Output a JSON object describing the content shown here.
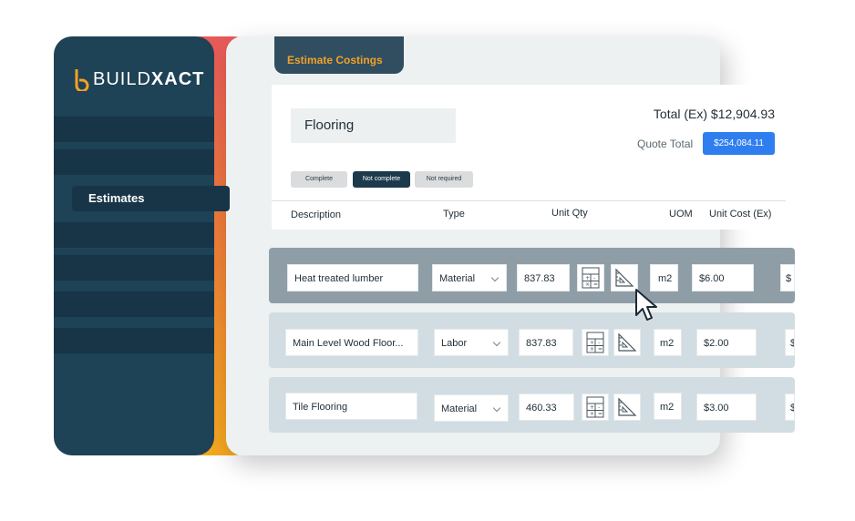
{
  "brand": {
    "name_light": "BUILD",
    "name_bold": "XACT"
  },
  "sidebar": {
    "active_item": "Estimates"
  },
  "tab": {
    "label": "Estimate Costings"
  },
  "header": {
    "category": "Flooring",
    "total_label": "Total (Ex) $12,904.93",
    "quote_total_label": "Quote Total",
    "quote_total_value": "$254,084.11"
  },
  "status_pills": [
    "Complete",
    "Not complete",
    "Not required"
  ],
  "columns": [
    "Description",
    "Type",
    "Unit Qty",
    "UOM",
    "Unit Cost (Ex)"
  ],
  "rows": [
    {
      "description": "Heat treated lumber",
      "type": "Material",
      "qty": "837.83",
      "uom": "m2",
      "unit_cost": "$6.00",
      "extra": "$"
    },
    {
      "description": "Main Level Wood Floor...",
      "type": "Labor",
      "qty": "837.83",
      "uom": "m2",
      "unit_cost": "$2.00",
      "extra": "$"
    },
    {
      "description": "Tile Flooring",
      "type": "Material",
      "qty": "460.33",
      "uom": "m2",
      "unit_cost": "$3.00",
      "extra": "$"
    }
  ],
  "colors": {
    "sidebar": "#1e4256",
    "accent_orange": "#f1a126",
    "quote_button": "#2f7ef0",
    "selected_row": "#8f9ea6",
    "row": "#d1dde3"
  },
  "icons": [
    "calculator-icon",
    "set-square-icon",
    "mouse-pointer-icon",
    "caret-down-icon"
  ]
}
